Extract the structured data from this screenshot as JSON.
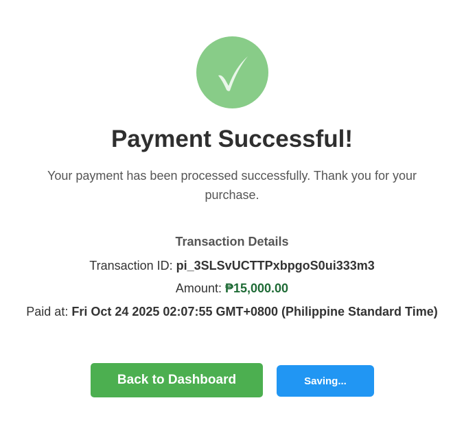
{
  "status": {
    "icon": "checkmark-icon",
    "title": "Payment Successful!",
    "message": "Your payment has been processed successfully. Thank you for your purchase."
  },
  "details": {
    "heading": "Transaction Details",
    "transaction_id_label": "Transaction ID:",
    "transaction_id": "pi_3SLSvUCTTPxbpgoS0ui333m3",
    "amount_label": "Amount:",
    "amount": "₱15,000.00",
    "paid_at_label": "Paid at:",
    "paid_at": "Fri Oct 24 2025 02:07:55 GMT+0800 (Philippine Standard Time)"
  },
  "actions": {
    "back_label": "Back to Dashboard",
    "saving_label": "Saving..."
  },
  "colors": {
    "success_circle": "#88cc88",
    "primary_button": "#4caf50",
    "secondary_button": "#2196f3",
    "amount_text": "#1f6b36"
  }
}
